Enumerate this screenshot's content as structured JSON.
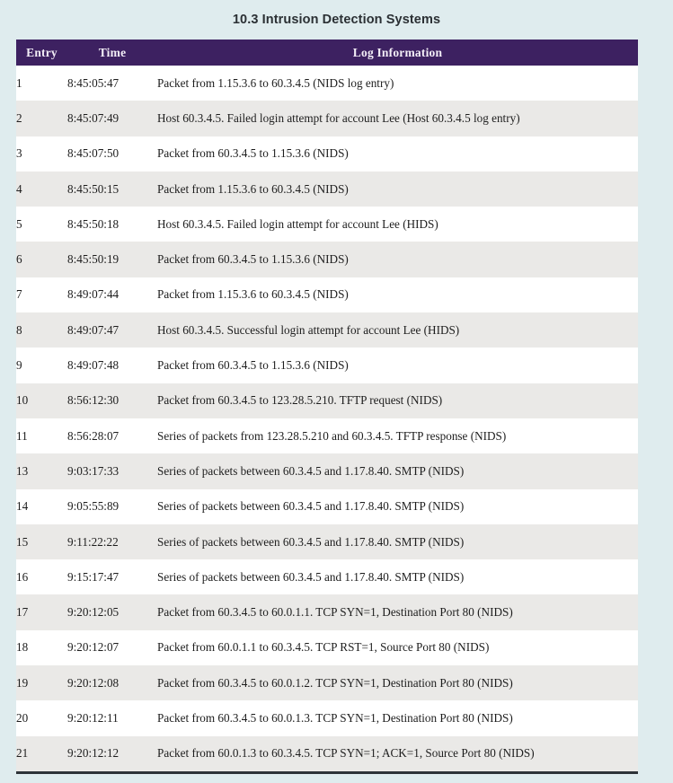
{
  "page": {
    "title": "10.3 Intrusion Detection Systems",
    "background_color": "#dfecee",
    "header_color": "#3d2161",
    "stripe_color": "#eae9e7",
    "bottom_border_color": "#2d3338"
  },
  "table": {
    "columns": [
      {
        "key": "entry",
        "label": "Entry"
      },
      {
        "key": "time",
        "label": "Time"
      },
      {
        "key": "log",
        "label": "Log Information"
      }
    ],
    "rows": [
      {
        "entry": "1",
        "time": "8:45:05:47",
        "log": "Packet from 1.15.3.6 to 60.3.4.5 (NIDS log entry)"
      },
      {
        "entry": "2",
        "time": "8:45:07:49",
        "log": "Host 60.3.4.5. Failed login attempt for account Lee (Host 60.3.4.5 log entry)"
      },
      {
        "entry": "3",
        "time": "8:45:07:50",
        "log": "Packet from 60.3.4.5 to 1.15.3.6 (NIDS)"
      },
      {
        "entry": "4",
        "time": "8:45:50:15",
        "log": "Packet from 1.15.3.6 to 60.3.4.5 (NIDS)"
      },
      {
        "entry": "5",
        "time": "8:45:50:18",
        "log": "Host 60.3.4.5. Failed login attempt for account Lee (HIDS)"
      },
      {
        "entry": "6",
        "time": "8:45:50:19",
        "log": "Packet from 60.3.4.5 to 1.15.3.6 (NIDS)"
      },
      {
        "entry": "7",
        "time": "8:49:07:44",
        "log": "Packet from 1.15.3.6 to 60.3.4.5 (NIDS)"
      },
      {
        "entry": "8",
        "time": "8:49:07:47",
        "log": "Host 60.3.4.5. Successful login attempt for account Lee (HIDS)"
      },
      {
        "entry": "9",
        "time": "8:49:07:48",
        "log": "Packet from 60.3.4.5 to 1.15.3.6 (NIDS)"
      },
      {
        "entry": "10",
        "time": "8:56:12:30",
        "log": "Packet from 60.3.4.5 to 123.28.5.210. TFTP request (NIDS)"
      },
      {
        "entry": "11",
        "time": "8:56:28:07",
        "log": "Series of packets from 123.28.5.210 and 60.3.4.5. TFTP response (NIDS)"
      },
      {
        "entry": "13",
        "time": "9:03:17:33",
        "log": "Series of packets between 60.3.4.5 and 1.17.8.40. SMTP (NIDS)"
      },
      {
        "entry": "14",
        "time": "9:05:55:89",
        "log": "Series of packets between 60.3.4.5 and 1.17.8.40. SMTP (NIDS)"
      },
      {
        "entry": "15",
        "time": "9:11:22:22",
        "log": "Series of packets between 60.3.4.5 and 1.17.8.40. SMTP (NIDS)"
      },
      {
        "entry": "16",
        "time": "9:15:17:47",
        "log": "Series of packets between 60.3.4.5 and 1.17.8.40. SMTP (NIDS)"
      },
      {
        "entry": "17",
        "time": "9:20:12:05",
        "log": "Packet from 60.3.4.5 to 60.0.1.1. TCP SYN=1, Destination Port 80 (NIDS)"
      },
      {
        "entry": "18",
        "time": "9:20:12:07",
        "log": "Packet from 60.0.1.1 to 60.3.4.5. TCP RST=1, Source Port 80 (NIDS)"
      },
      {
        "entry": "19",
        "time": "9:20:12:08",
        "log": "Packet from 60.3.4.5 to 60.0.1.2. TCP SYN=1, Destination Port 80 (NIDS)"
      },
      {
        "entry": "20",
        "time": "9:20:12:11",
        "log": "Packet from 60.3.4.5 to 60.0.1.3. TCP SYN=1, Destination Port 80 (NIDS)"
      },
      {
        "entry": "21",
        "time": "9:20:12:12",
        "log": "Packet from 60.0.1.3 to 60.3.4.5. TCP SYN=1; ACK=1, Source Port 80 (NIDS)"
      }
    ]
  }
}
